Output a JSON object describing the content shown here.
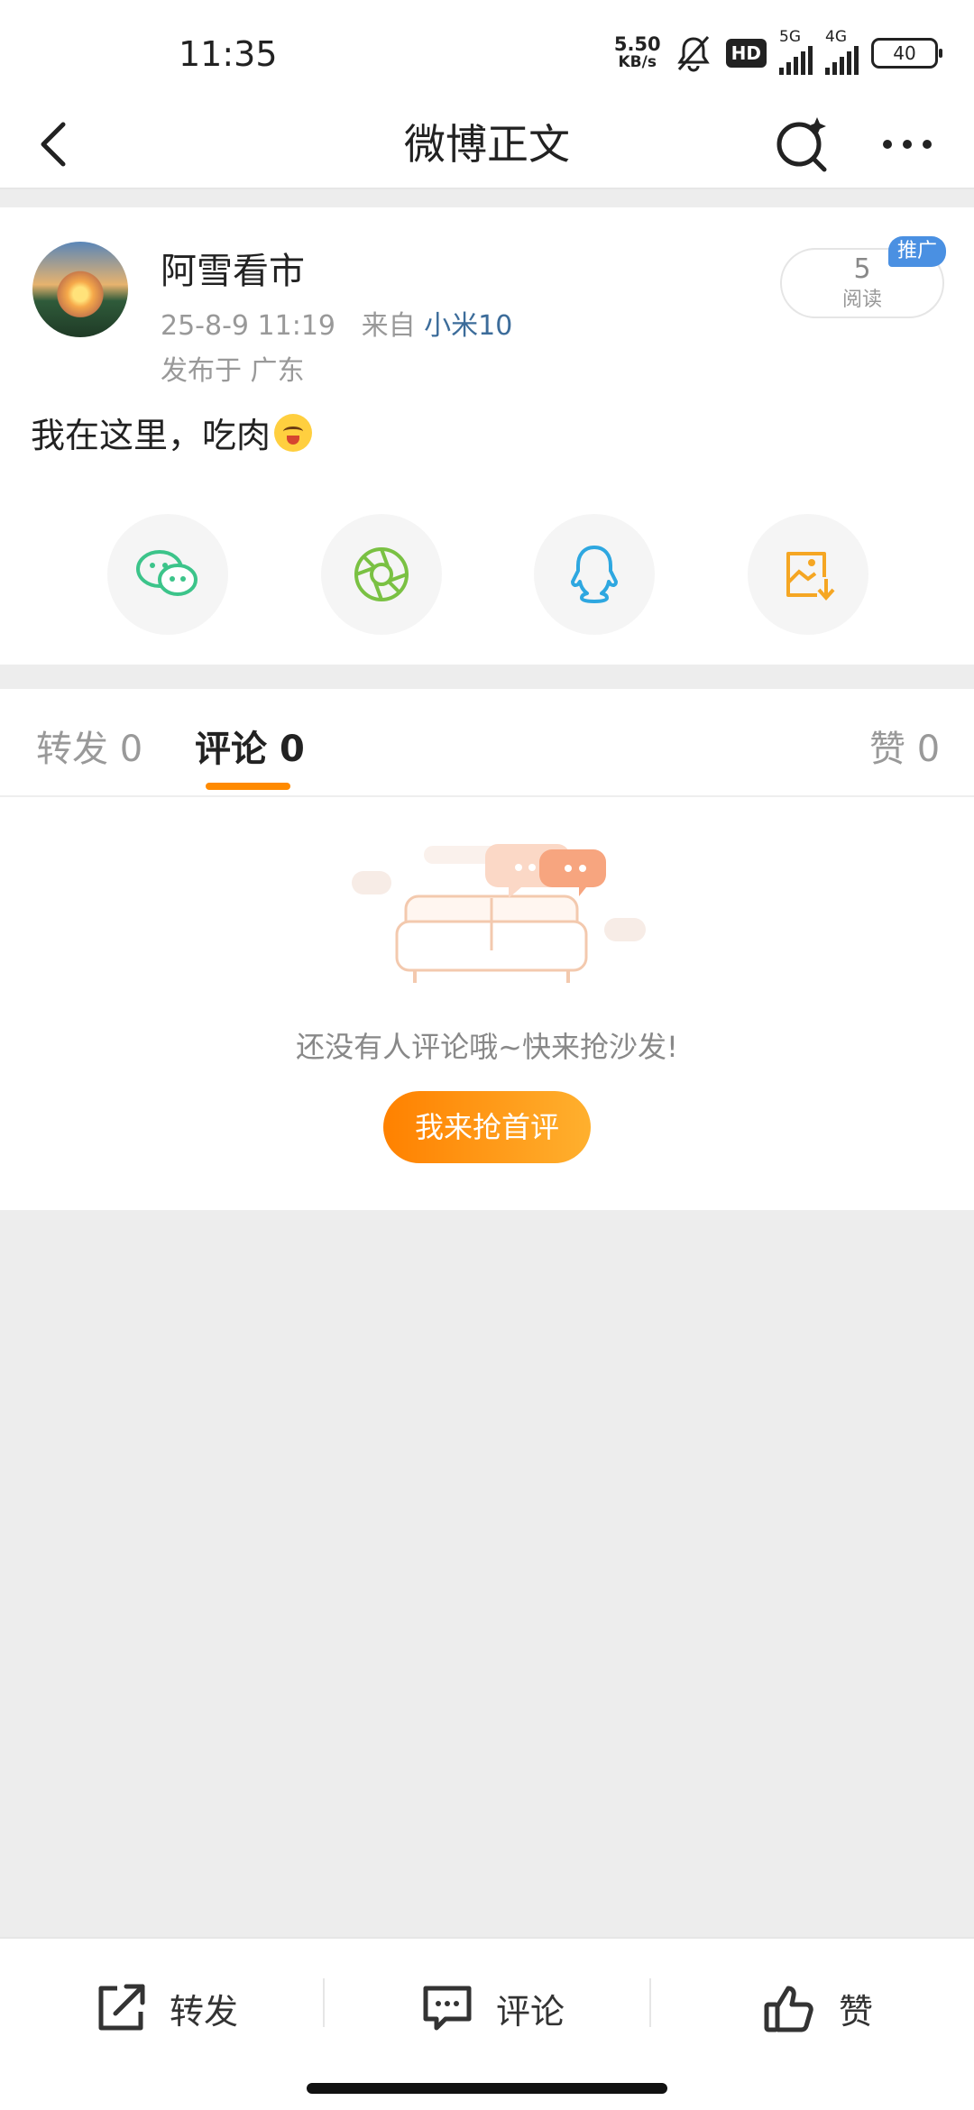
{
  "status_bar": {
    "time": "11:35",
    "net_speed_value": "5.50",
    "net_speed_unit": "KB/s",
    "hd_label": "HD",
    "sim1_label": "5G",
    "sim2_label": "4G",
    "battery": "40",
    "icons": [
      "mute-icon",
      "signal-icon",
      "battery-icon"
    ]
  },
  "nav": {
    "title": "微博正文",
    "icons": [
      "back-icon",
      "search-icon",
      "more-icon"
    ]
  },
  "post": {
    "author": "阿雪看市",
    "time": "25-8-9 11:19",
    "source_prefix": "来自",
    "device": "小米10",
    "location": "发布于 广东",
    "read_count": "5",
    "read_label": "阅读",
    "promo_label": "推广",
    "text": "我在这里，吃肉",
    "share_targets": [
      "wechat-icon",
      "moments-icon",
      "qq-icon",
      "save-image-icon"
    ]
  },
  "tabs": [
    {
      "label": "转发",
      "count": "0"
    },
    {
      "label": "评论",
      "count": "0"
    },
    {
      "label": "赞",
      "count": "0"
    }
  ],
  "empty_state": {
    "message": "还没有人评论哦~快来抢沙发!",
    "button": "我来抢首评"
  },
  "toolbar": {
    "repost": "转发",
    "comment": "评论",
    "like": "赞"
  },
  "colors": {
    "accent": "#ff8a00",
    "link": "#3c6c9a",
    "promo": "#4a90e2"
  }
}
